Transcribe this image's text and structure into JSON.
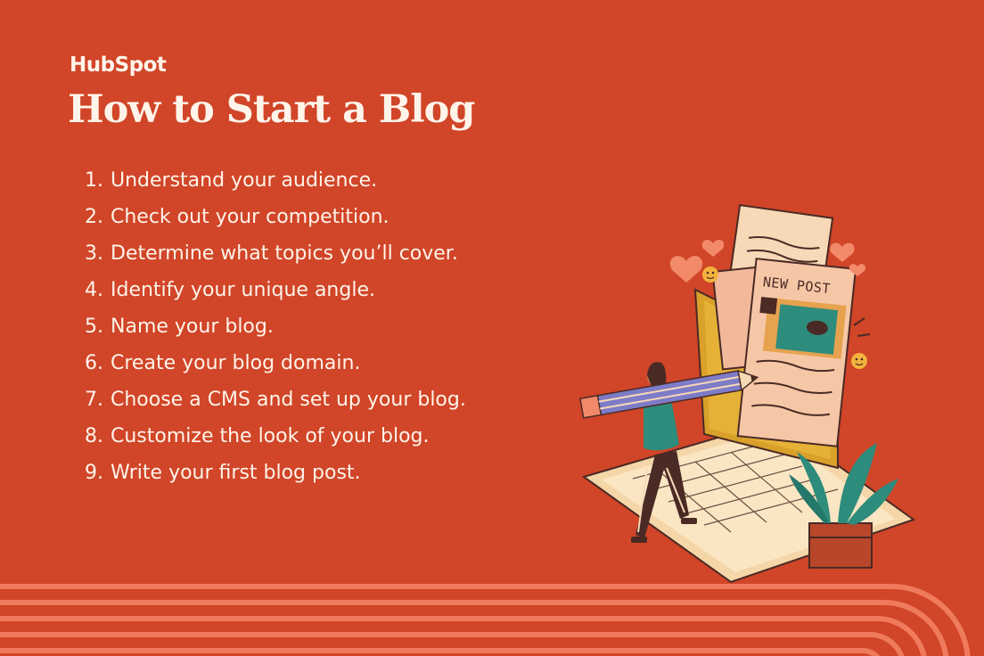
{
  "brand": {
    "logo_text": "HubSpot"
  },
  "title": "How to Start a Blog",
  "steps": [
    {
      "num": "1.",
      "text": "Understand your audience."
    },
    {
      "num": "2.",
      "text": "Check out your competition."
    },
    {
      "num": "3.",
      "text": "Determine what topics you’ll cover."
    },
    {
      "num": "4.",
      "text": "Identify your unique angle."
    },
    {
      "num": "5.",
      "text": "Name your blog."
    },
    {
      "num": "6.",
      "text": "Create your blog domain."
    },
    {
      "num": "7.",
      "text": "Choose a CMS and set up your blog."
    },
    {
      "num": "8.",
      "text": "Customize the look of your blog."
    },
    {
      "num": "9.",
      "text": "Write your first blog post."
    }
  ],
  "illustration": {
    "post_label": "NEW POST"
  },
  "colors": {
    "background": "#D14528",
    "text": "#FFF4EA",
    "stripe": "#F07B5C"
  }
}
